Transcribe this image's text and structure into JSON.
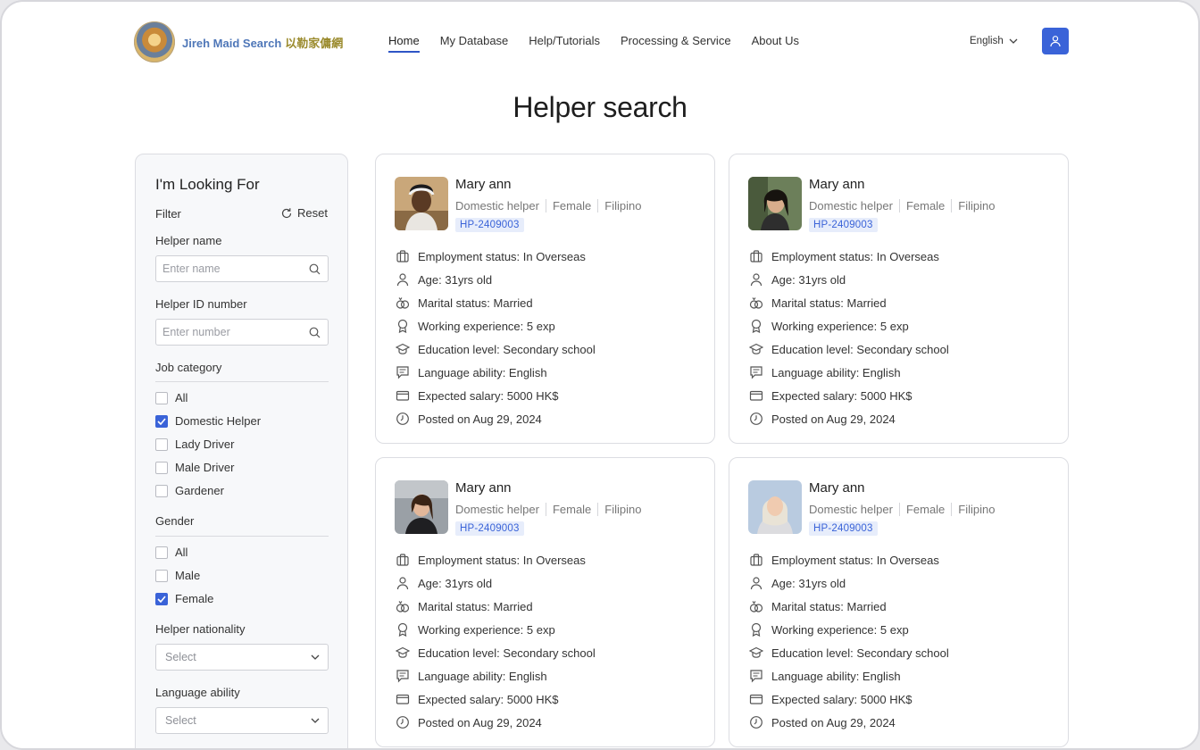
{
  "header": {
    "logo_text_en": "Jireh Maid Search",
    "logo_text_zh": "以勒家傭網",
    "nav": [
      {
        "label": "Home",
        "active": true
      },
      {
        "label": "My Database",
        "active": false
      },
      {
        "label": "Help/Tutorials",
        "active": false
      },
      {
        "label": "Processing & Service",
        "active": false
      },
      {
        "label": "About Us",
        "active": false
      }
    ],
    "language": "English",
    "user_icon": "user-icon",
    "accent": "#3a63d8"
  },
  "page_title": "Helper search",
  "filter": {
    "title": "I'm Looking For",
    "filter_label": "Filter",
    "reset_label": "Reset",
    "helper_name_label": "Helper name",
    "helper_name_placeholder": "Enter name",
    "helper_id_label": "Helper ID number",
    "helper_id_placeholder": "Enter number",
    "job_category_label": "Job category",
    "job_categories": [
      {
        "label": "All",
        "checked": false
      },
      {
        "label": "Domestic Helper",
        "checked": true
      },
      {
        "label": "Lady Driver",
        "checked": false
      },
      {
        "label": "Male Driver",
        "checked": false
      },
      {
        "label": "Gardener",
        "checked": false
      }
    ],
    "gender_label": "Gender",
    "genders": [
      {
        "label": "All",
        "checked": false
      },
      {
        "label": "Male",
        "checked": false
      },
      {
        "label": "Female",
        "checked": true
      }
    ],
    "nationality_label": "Helper nationality",
    "nationality_value": "Select",
    "language_label": "Language ability",
    "language_value": "Select"
  },
  "cards": [
    {
      "name": "Mary ann",
      "role": "Domestic helper",
      "gender": "Female",
      "nationality": "Filipino",
      "id": "HP-2409003",
      "details": [
        {
          "icon": "briefcase-icon",
          "text": "Employment status: In Overseas"
        },
        {
          "icon": "person-icon",
          "text": "Age: 31yrs old"
        },
        {
          "icon": "rings-icon",
          "text": "Marital status: Married"
        },
        {
          "icon": "award-icon",
          "text": "Working experience: 5 exp"
        },
        {
          "icon": "graduation-cap-icon",
          "text": "Education level: Secondary school"
        },
        {
          "icon": "chat-icon",
          "text": "Language ability: English"
        },
        {
          "icon": "wallet-icon",
          "text": "Expected salary: 5000 HK$"
        },
        {
          "icon": "clock-icon",
          "text": "Posted on Aug 29, 2024"
        }
      ]
    },
    {
      "name": "Mary ann",
      "role": "Domestic helper",
      "gender": "Female",
      "nationality": "Filipino",
      "id": "HP-2409003",
      "details": [
        {
          "icon": "briefcase-icon",
          "text": "Employment status: In Overseas"
        },
        {
          "icon": "person-icon",
          "text": "Age: 31yrs old"
        },
        {
          "icon": "rings-icon",
          "text": "Marital status: Married"
        },
        {
          "icon": "award-icon",
          "text": "Working experience: 5 exp"
        },
        {
          "icon": "graduation-cap-icon",
          "text": "Education level: Secondary school"
        },
        {
          "icon": "chat-icon",
          "text": "Language ability: English"
        },
        {
          "icon": "wallet-icon",
          "text": "Expected salary: 5000 HK$"
        },
        {
          "icon": "clock-icon",
          "text": "Posted on Aug 29, 2024"
        }
      ]
    },
    {
      "name": "Mary ann",
      "role": "Domestic helper",
      "gender": "Female",
      "nationality": "Filipino",
      "id": "HP-2409003",
      "details": [
        {
          "icon": "briefcase-icon",
          "text": "Employment status: In Overseas"
        },
        {
          "icon": "person-icon",
          "text": "Age: 31yrs old"
        },
        {
          "icon": "rings-icon",
          "text": "Marital status: Married"
        },
        {
          "icon": "award-icon",
          "text": "Working experience: 5 exp"
        },
        {
          "icon": "graduation-cap-icon",
          "text": "Education level: Secondary school"
        },
        {
          "icon": "chat-icon",
          "text": "Language ability: English"
        },
        {
          "icon": "wallet-icon",
          "text": "Expected salary: 5000 HK$"
        },
        {
          "icon": "clock-icon",
          "text": "Posted on Aug 29, 2024"
        }
      ]
    },
    {
      "name": "Mary ann",
      "role": "Domestic helper",
      "gender": "Female",
      "nationality": "Filipino",
      "id": "HP-2409003",
      "details": [
        {
          "icon": "briefcase-icon",
          "text": "Employment status: In Overseas"
        },
        {
          "icon": "person-icon",
          "text": "Age: 31yrs old"
        },
        {
          "icon": "rings-icon",
          "text": "Marital status: Married"
        },
        {
          "icon": "award-icon",
          "text": "Working experience: 5 exp"
        },
        {
          "icon": "graduation-cap-icon",
          "text": "Education level: Secondary school"
        },
        {
          "icon": "chat-icon",
          "text": "Language ability: English"
        },
        {
          "icon": "wallet-icon",
          "text": "Expected salary: 5000 HK$"
        },
        {
          "icon": "clock-icon",
          "text": "Posted on Aug 29, 2024"
        }
      ]
    }
  ]
}
